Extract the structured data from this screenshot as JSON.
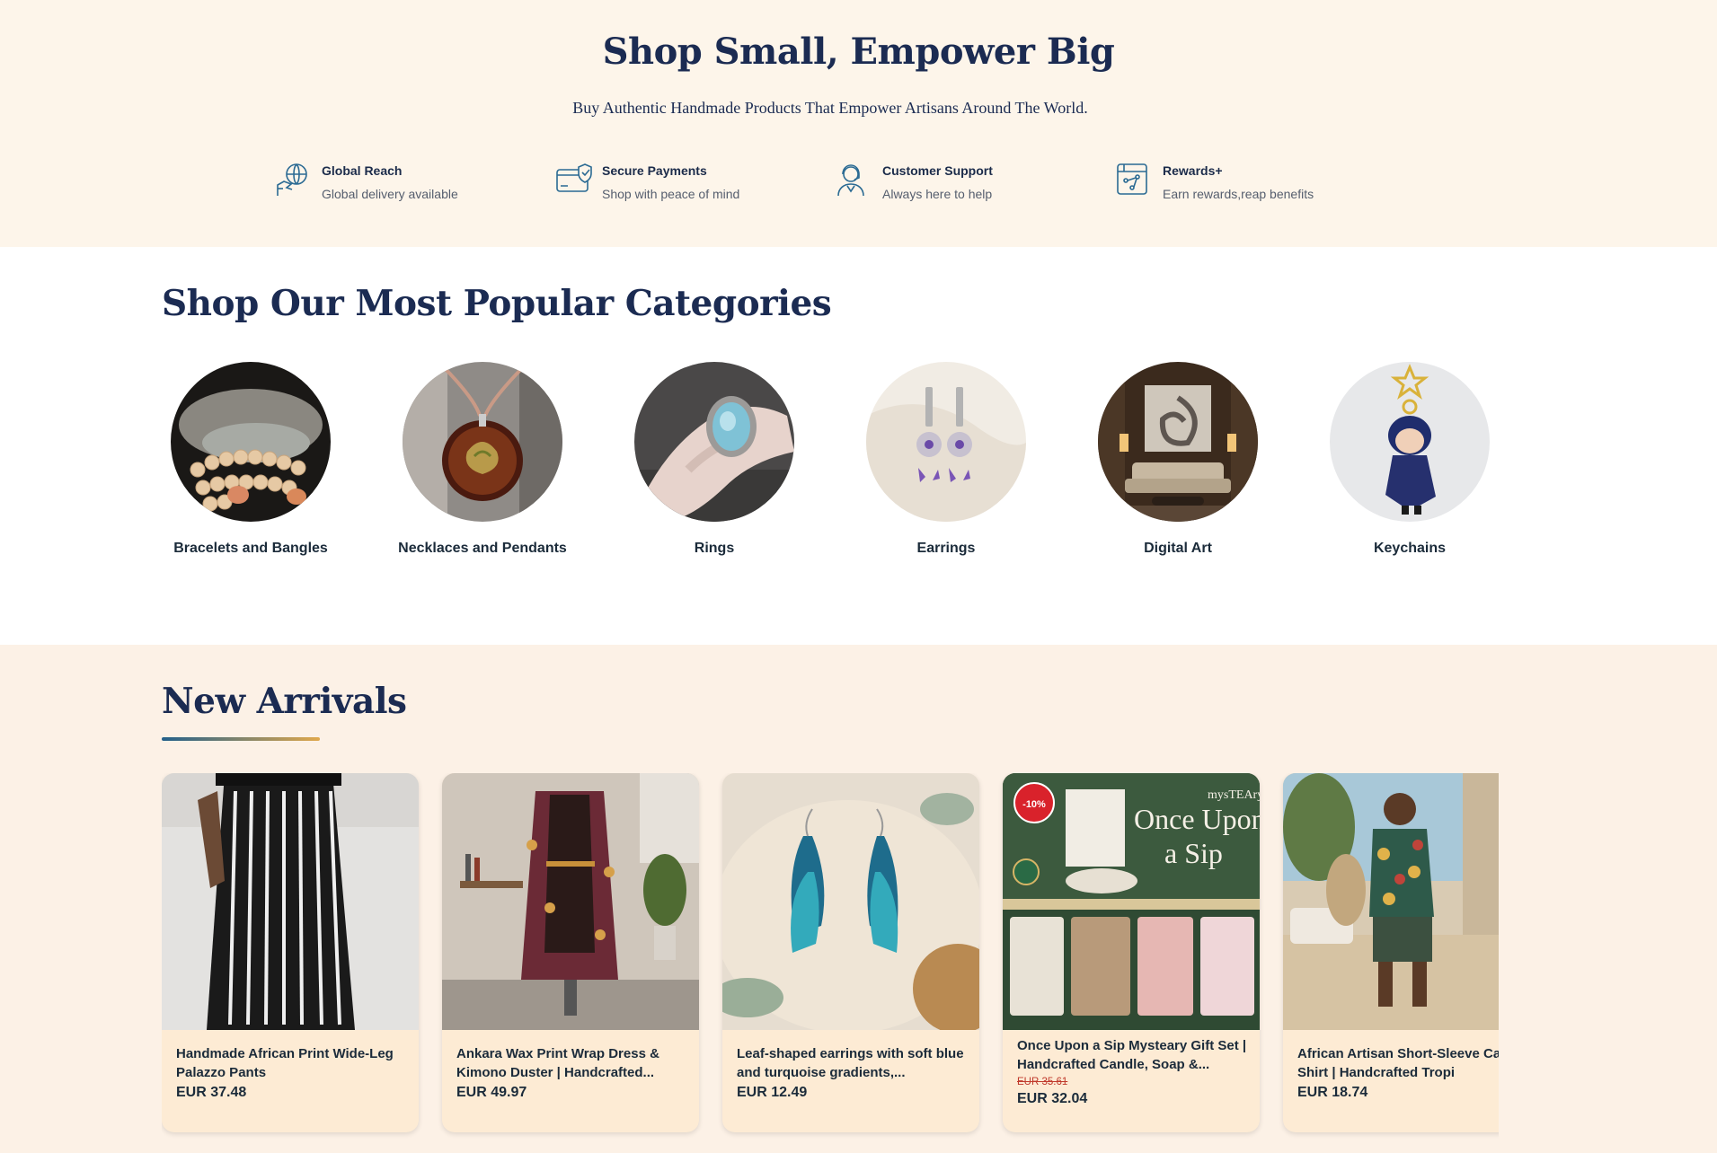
{
  "hero": {
    "title": "Shop Small, Empower Big",
    "subtitle": "Buy Authentic Handmade Products That Empower Artisans Around The World."
  },
  "features": [
    {
      "icon": "globe-hand-icon",
      "title": "Global Reach",
      "desc": "Global delivery available"
    },
    {
      "icon": "secure-card-icon",
      "title": "Secure Payments",
      "desc": "Shop with peace of mind"
    },
    {
      "icon": "support-agent-icon",
      "title": "Customer Support",
      "desc": "Always here to help"
    },
    {
      "icon": "rewards-icon",
      "title": "Rewards+",
      "desc": "Earn rewards,reap benefits"
    }
  ],
  "categories": {
    "title": "Shop Our Most Popular Categories",
    "items": [
      {
        "label": "Bracelets and Bangles"
      },
      {
        "label": "Necklaces and Pendants"
      },
      {
        "label": "Rings"
      },
      {
        "label": "Earrings"
      },
      {
        "label": "Digital Art"
      },
      {
        "label": "Keychains"
      }
    ]
  },
  "arrivals": {
    "title": "New Arrivals",
    "products": [
      {
        "name": "Handmade African Print Wide-Leg Palazzo Pants",
        "price": "EUR 37.48"
      },
      {
        "name": "Ankara Wax Print Wrap Dress & Kimono Duster | Handcrafted...",
        "price": "EUR 49.97"
      },
      {
        "name": "Leaf-shaped earrings with soft blue and turquoise gradients,...",
        "price": "EUR 12.49"
      },
      {
        "name": "Once Upon a Sip Mysteary Gift Set | Handcrafted Candle, Soap &...",
        "old_price": "EUR 35.61",
        "price": "EUR 32.04",
        "badge": "-10%",
        "image_text": {
          "brand": "mysTEAry",
          "headline_1": "Once Upon",
          "headline_2": "a Sip"
        }
      },
      {
        "name": "African Artisan Short-Sleeve Camp Shirt | Handcrafted Tropi",
        "price": "EUR 18.74"
      }
    ]
  },
  "colors": {
    "navy": "#1b2b52",
    "cream": "#fdf5ea",
    "sale": "#d9222b",
    "card": "#fdebd4"
  }
}
